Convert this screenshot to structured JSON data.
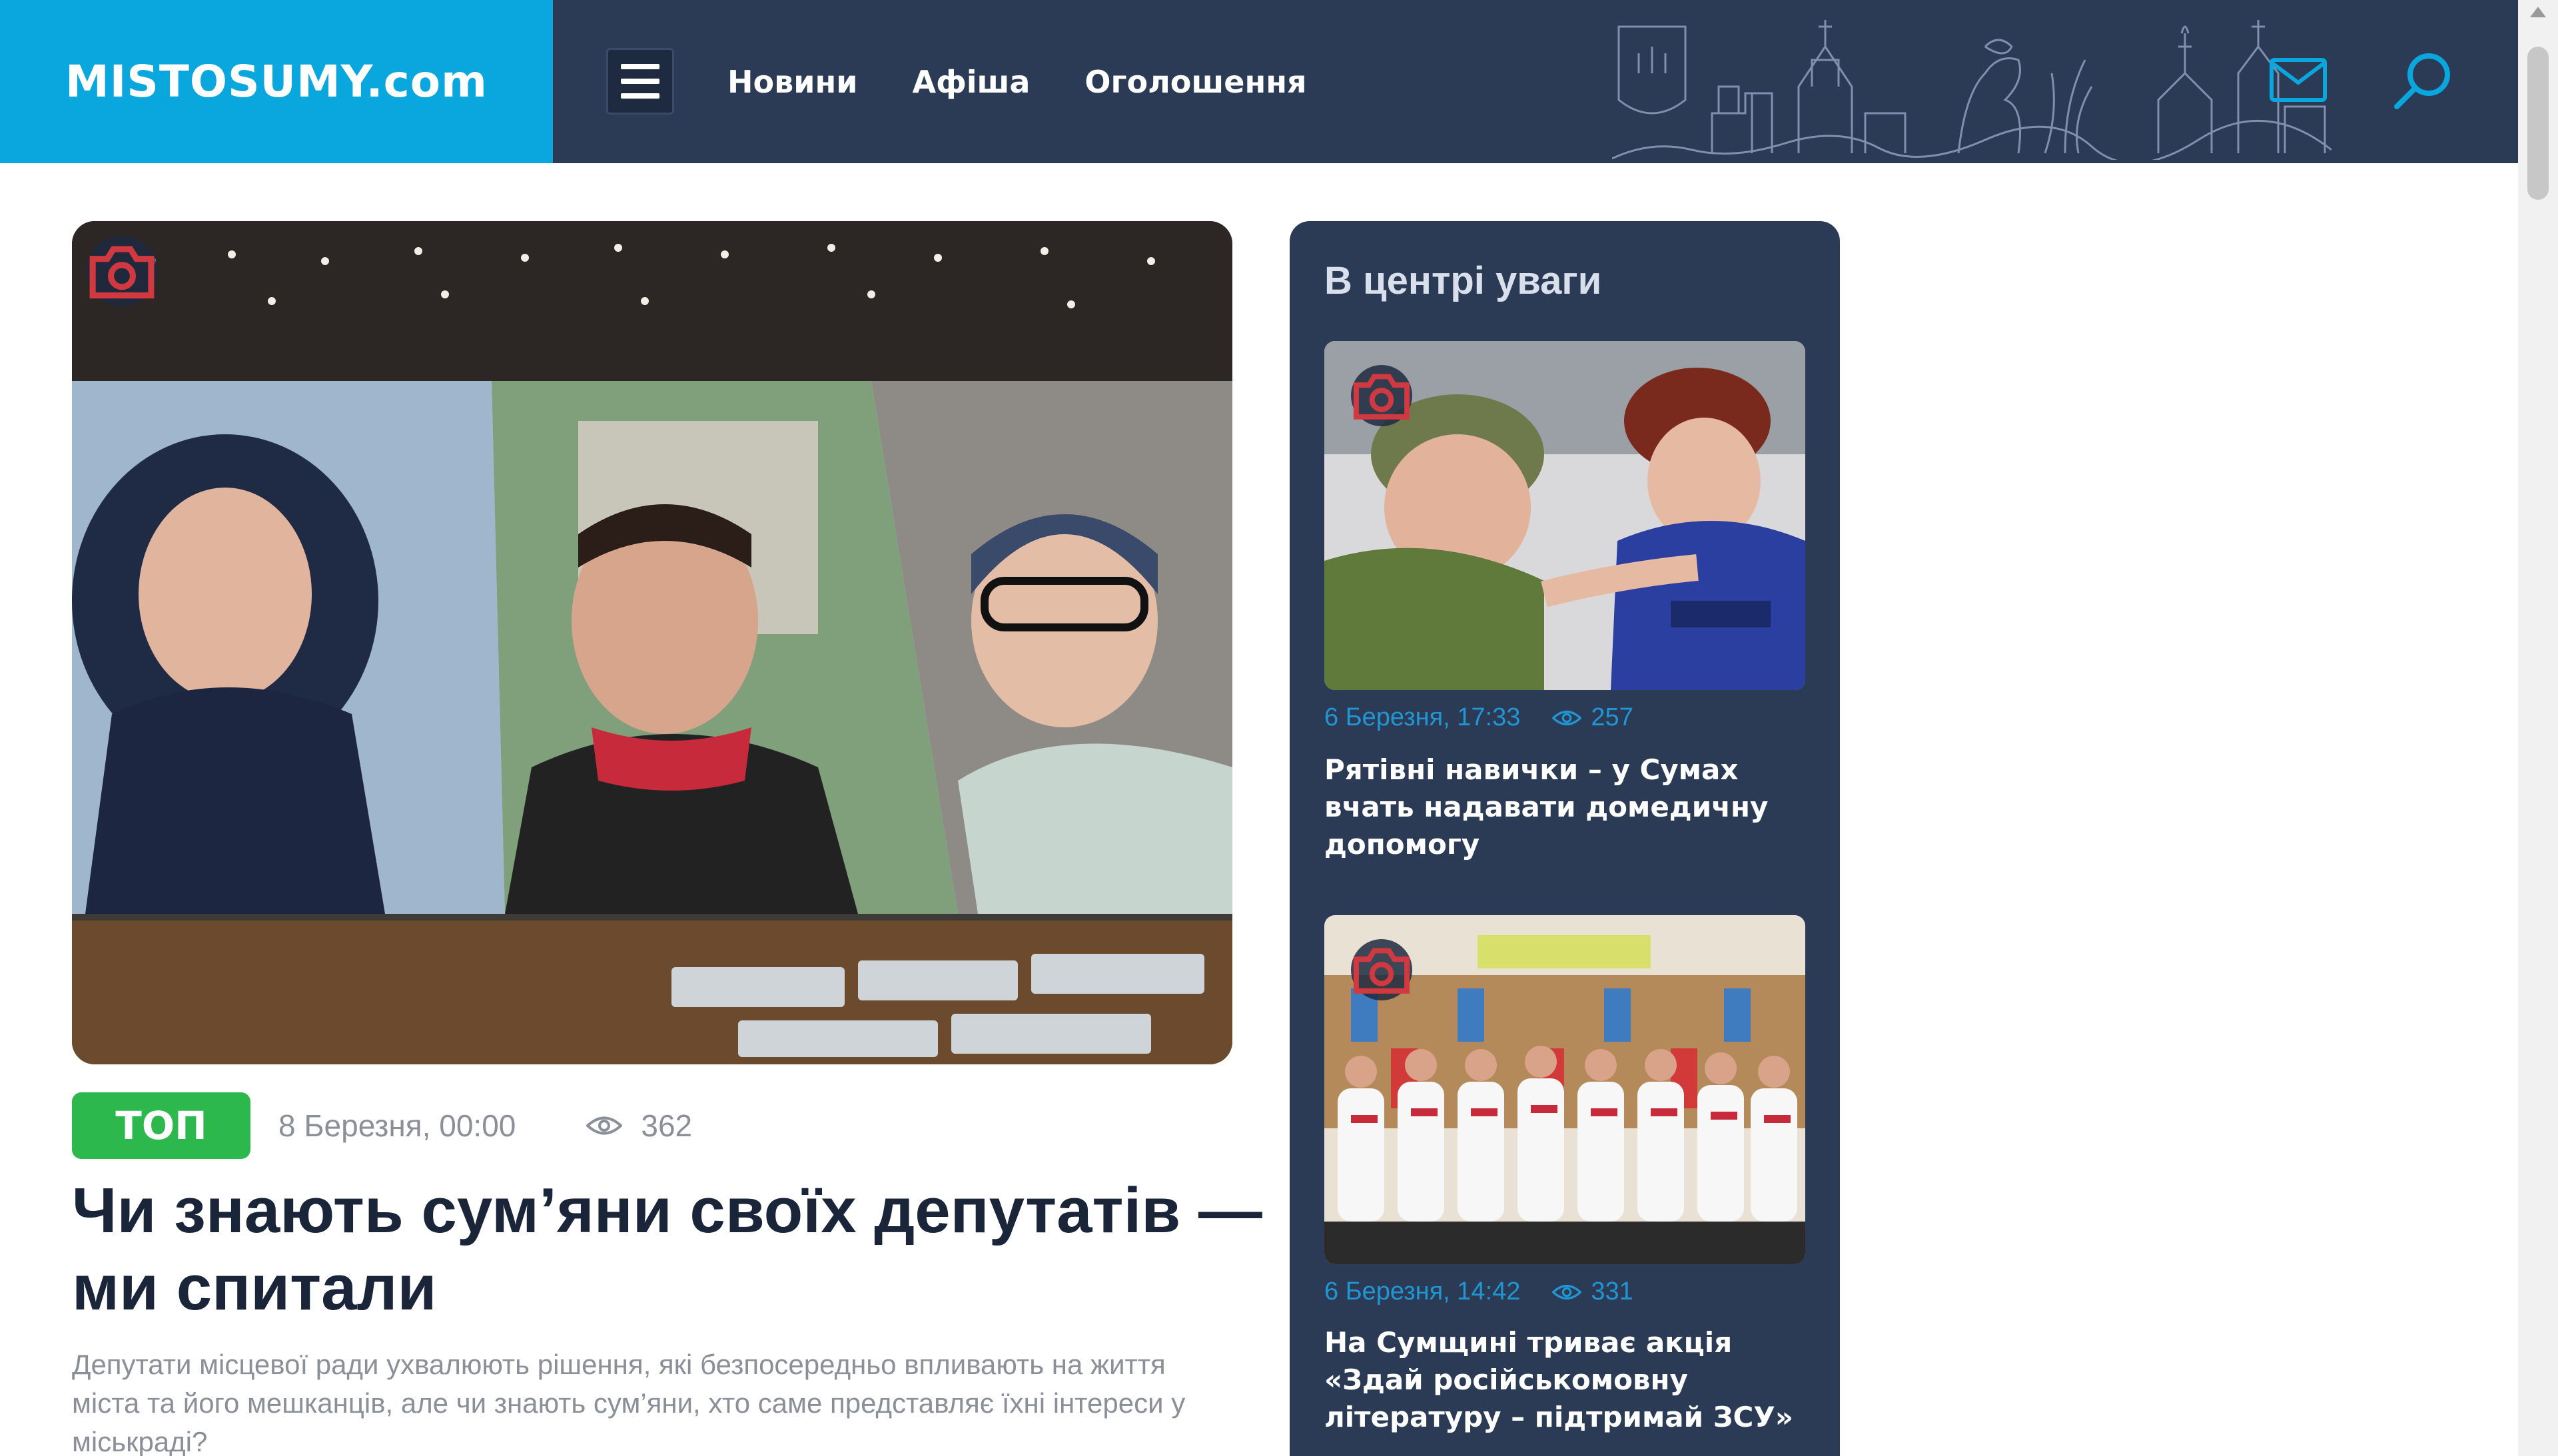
{
  "header": {
    "logo": "MISTOSUMY.com",
    "nav": [
      "Новини",
      "Афіша",
      "Оголошення"
    ],
    "icons": [
      "menu-icon",
      "mail-icon",
      "search-icon"
    ]
  },
  "colors": {
    "brand_blue": "#0aa6de",
    "header_bg": "#2b3a55",
    "top_badge": "#2db84d",
    "meta_blue": "#2196d3",
    "headline": "#1b2539"
  },
  "hero": {
    "badge": "ТОП",
    "date": "8 Березня, 00:00",
    "views": "362",
    "title": "Чи знають сум’яни своїх депутатів — ми спитали",
    "lead": "Депутати місцевої ради ухвалюють рішення, які безпосередньо впливають на життя міста та його мешканців, але чи знають сум’яни, хто саме представляє їхні інтереси у міськраді?"
  },
  "sidebar": {
    "title": "В центрі уваги",
    "cards": [
      {
        "date": "6 Березня, 17:33",
        "views": "257",
        "title": "Рятівні навички – у Сумах вчать надавати домедичну допомогу"
      },
      {
        "date": "6 Березня, 14:42",
        "views": "331",
        "title": "На Сумщині триває акція «Здай російськомовну літературу – підтримай ЗСУ»"
      }
    ]
  }
}
